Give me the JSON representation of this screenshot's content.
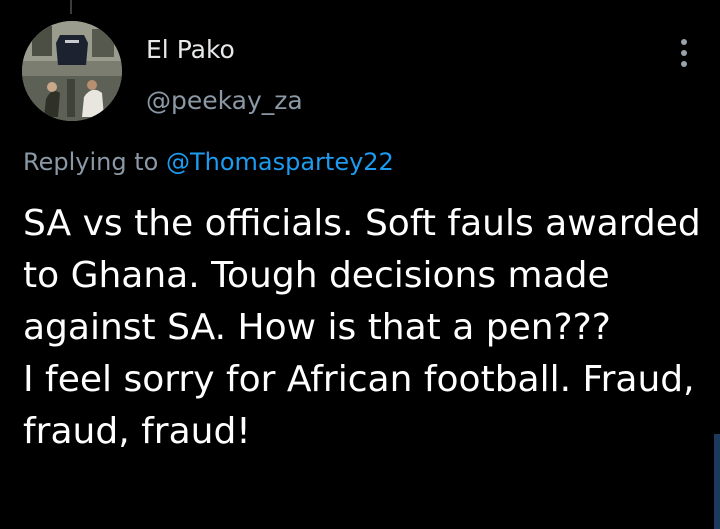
{
  "tweet": {
    "author": {
      "display_name": "El Pako",
      "handle": "@peekay_za"
    },
    "reply": {
      "prefix": "Replying to",
      "mention": "@Thomaspartey22"
    },
    "text": "SA vs the officials. Soft fauls awarded to Ghana. Tough decisions made against SA. How is that a pen???\nI feel sorry for African football. Fraud, fraud, fraud!"
  },
  "icons": {
    "more": "vertical-ellipsis-icon",
    "avatar": "profile-photo"
  },
  "colors": {
    "background": "#000000",
    "text_primary": "#ffffff",
    "text_secondary": "#8b98a5",
    "link": "#1d9bf0"
  }
}
